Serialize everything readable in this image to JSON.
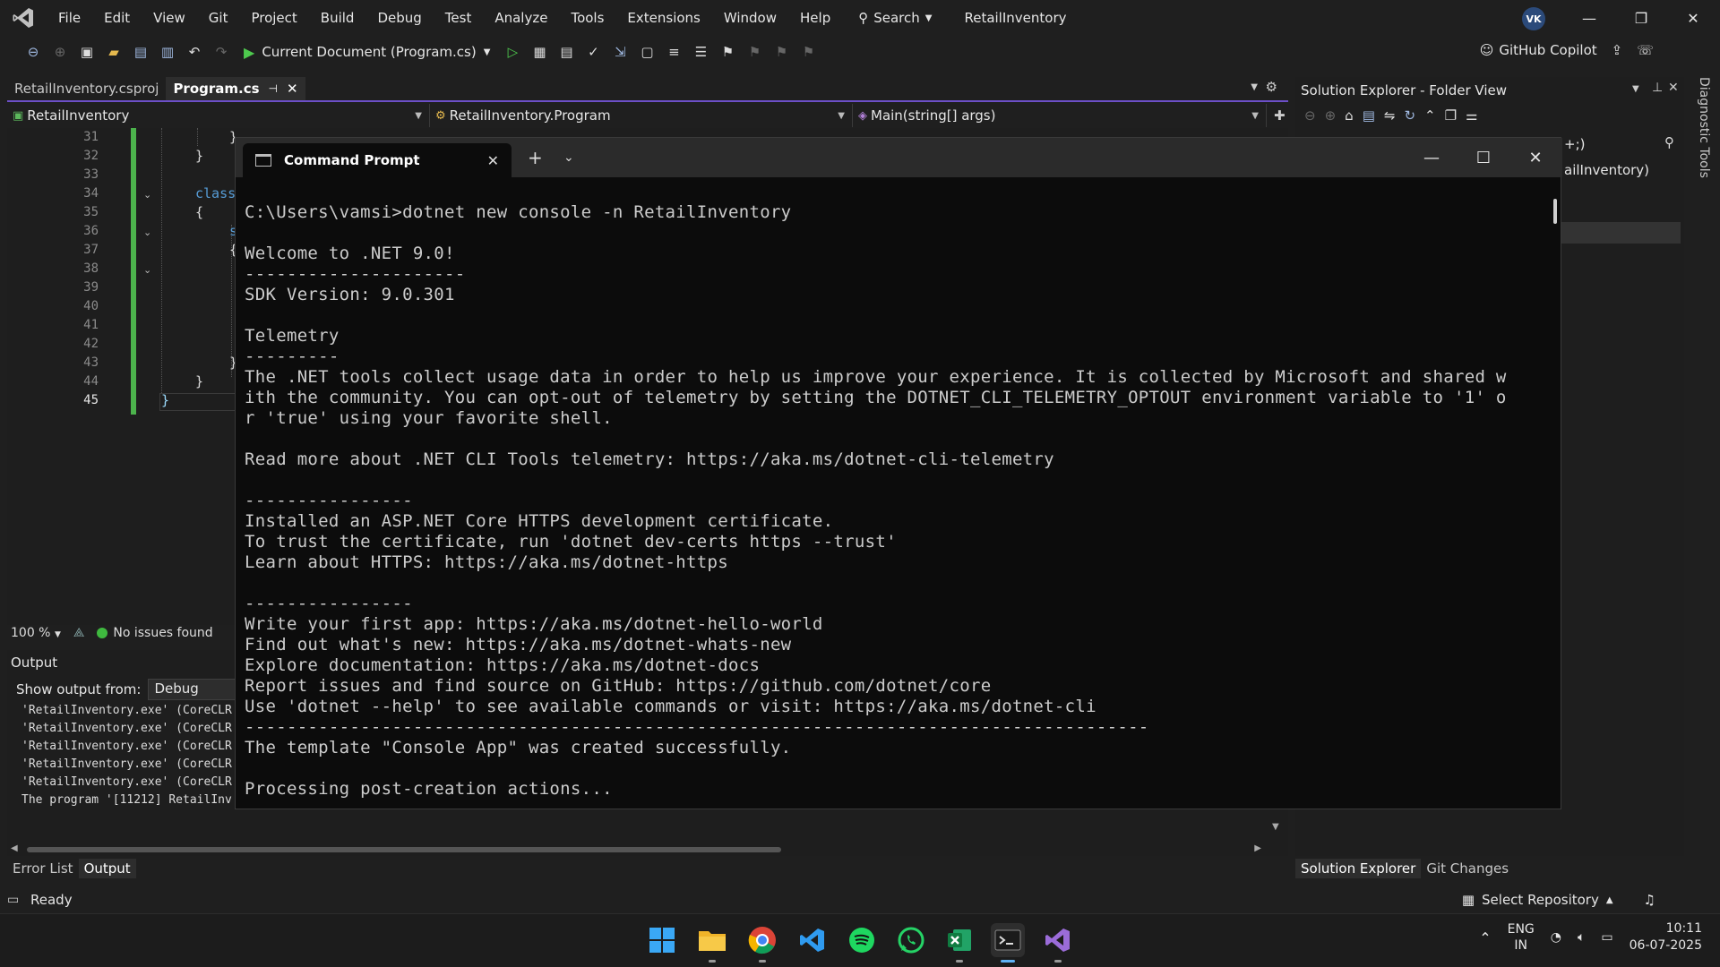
{
  "menu": [
    "File",
    "Edit",
    "View",
    "Git",
    "Project",
    "Build",
    "Debug",
    "Test",
    "Analyze",
    "Tools",
    "Extensions",
    "Window",
    "Help"
  ],
  "search_label": "Search",
  "app_title": "RetailInventory",
  "avatar_initials": "VK",
  "toolbar": {
    "run_target": "Current Document (Program.cs)",
    "copilot_label": "GitHub Copilot"
  },
  "doc_tabs": [
    {
      "label": "RetailInventory.csproj",
      "active": false
    },
    {
      "label": "Program.cs",
      "active": true
    }
  ],
  "navbar": {
    "project": "RetailInventory",
    "type": "RetailInventory.Program",
    "member": "Main(string[] args)"
  },
  "editor": {
    "line_numbers": [
      "31",
      "32",
      "33",
      "34",
      "35",
      "36",
      "37",
      "38",
      "39",
      "40",
      "41",
      "42",
      "43",
      "44",
      "45"
    ],
    "current_line": "45",
    "visible_code": {
      "l31": "}",
      "l32": "}",
      "l34": "class",
      "l35": "{",
      "l36": "s",
      "l37": "{",
      "l43": "}",
      "l44": "}",
      "l45": "}"
    },
    "zoom": "100 %",
    "issues": "No issues found"
  },
  "output": {
    "title": "Output",
    "show_from_label": "Show output from:",
    "show_from_value": "Debug",
    "lines": [
      "'RetailInventory.exe' (CoreCLR",
      "'RetailInventory.exe' (CoreCLR",
      "'RetailInventory.exe' (CoreCLR",
      "'RetailInventory.exe' (CoreCLR",
      "'RetailInventory.exe' (CoreCLR",
      "The program '[11212] RetailInv"
    ]
  },
  "bottom_tabs": [
    "Error List",
    "Output"
  ],
  "solution_explorer": {
    "title": "Solution Explorer - Folder View",
    "search_fragment": "+;)",
    "item_fragment": "ailInventory)",
    "tabs": [
      "Solution Explorer",
      "Git Changes"
    ],
    "side_label": "Diagnostic Tools"
  },
  "status": {
    "ready": "Ready",
    "repo": "Select Repository"
  },
  "cmd": {
    "tab_label": "Command Prompt",
    "lines": [
      "C:\\Users\\vamsi>dotnet new console -n RetailInventory",
      "",
      "Welcome to .NET 9.0!",
      "---------------------",
      "SDK Version: 9.0.301",
      "",
      "Telemetry",
      "---------",
      "The .NET tools collect usage data in order to help us improve your experience. It is collected by Microsoft and shared w",
      "ith the community. You can opt-out of telemetry by setting the DOTNET_CLI_TELEMETRY_OPTOUT environment variable to '1' o",
      "r 'true' using your favorite shell.",
      "",
      "Read more about .NET CLI Tools telemetry: https://aka.ms/dotnet-cli-telemetry",
      "",
      "----------------",
      "Installed an ASP.NET Core HTTPS development certificate.",
      "To trust the certificate, run 'dotnet dev-certs https --trust'",
      "Learn about HTTPS: https://aka.ms/dotnet-https",
      "",
      "----------------",
      "Write your first app: https://aka.ms/dotnet-hello-world",
      "Find out what's new: https://aka.ms/dotnet-whats-new",
      "Explore documentation: https://aka.ms/dotnet-docs",
      "Report issues and find source on GitHub: https://github.com/dotnet/core",
      "Use 'dotnet --help' to see available commands or visit: https://aka.ms/dotnet-cli",
      "--------------------------------------------------------------------------------------",
      "The template \"Console App\" was created successfully.",
      "",
      "Processing post-creation actions..."
    ]
  },
  "taskbar": {
    "apps": [
      "start-icon",
      "file-explorer-icon",
      "chrome-icon",
      "vscode-icon",
      "spotify-icon",
      "whatsapp-icon",
      "excel-icon",
      "terminal-icon",
      "visual-studio-icon"
    ],
    "lang_top": "ENG",
    "lang_bottom": "IN",
    "time": "10:11",
    "date": "06-07-2025"
  }
}
